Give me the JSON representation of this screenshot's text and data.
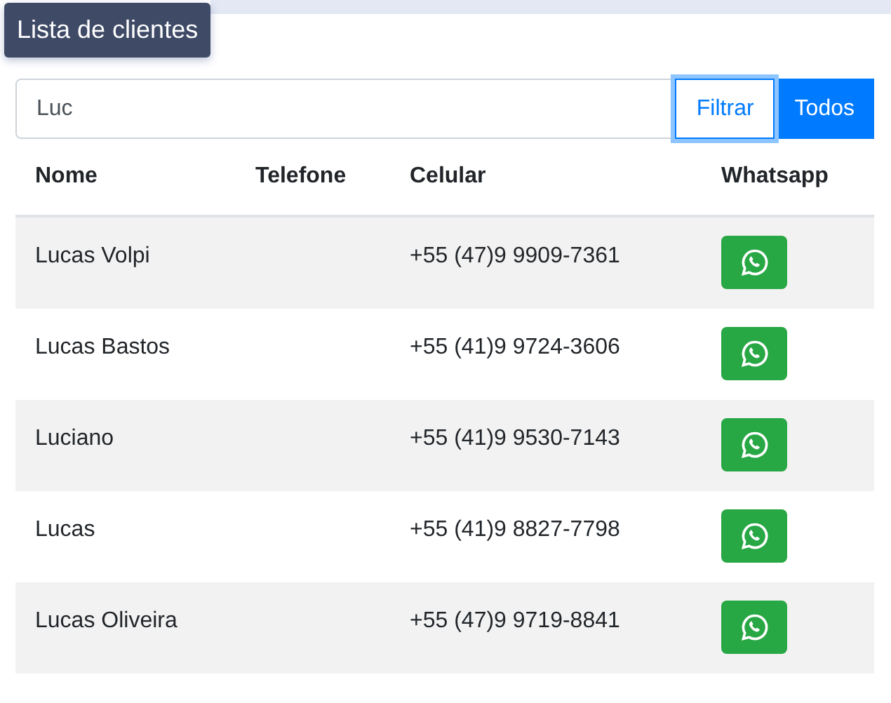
{
  "title": "Lista de clientes",
  "search": {
    "value": "Luc"
  },
  "buttons": [
    {
      "label": "Filtrar",
      "kind": "outline",
      "focused": true
    },
    {
      "label": "Todos",
      "kind": "solid",
      "focused": false
    }
  ],
  "table": {
    "columns": [
      "Nome",
      "Telefone",
      "Celular",
      "Whatsapp"
    ],
    "rows": [
      {
        "nome": "Lucas Volpi",
        "celular": "+55 (47)9 9909-7361"
      },
      {
        "nome": "Lucas Bastos",
        "celular": "+55 (41)9 9724-3606"
      },
      {
        "nome": "Luciano",
        "celular": "+55 (41)9 9530-7143"
      },
      {
        "nome": "Lucas",
        "celular": "+55 (41)9 8827-7798"
      },
      {
        "nome": "Lucas Oliveira",
        "celular": "+55 (47)9 9719-8841"
      }
    ]
  }
}
